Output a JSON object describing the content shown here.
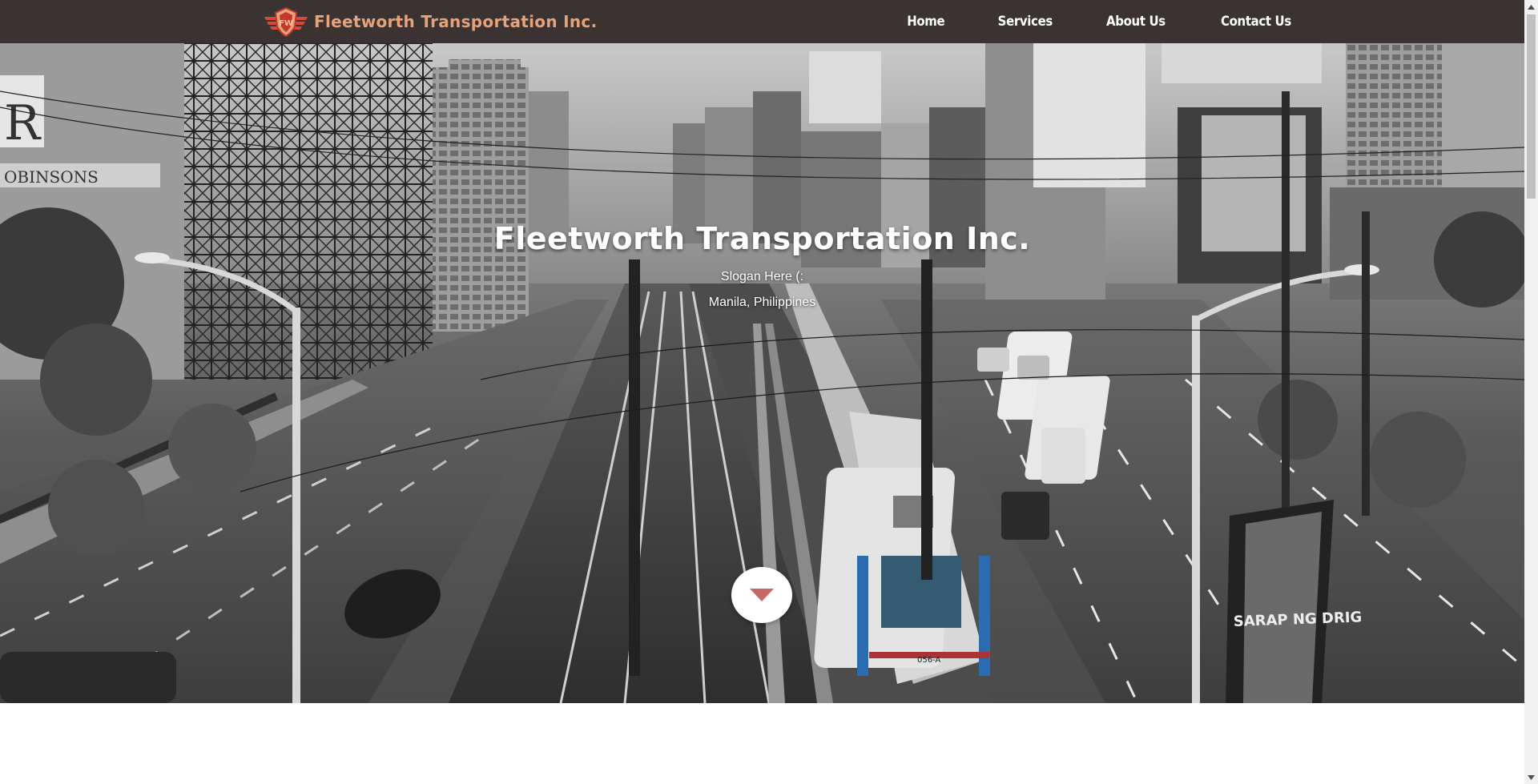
{
  "navbar": {
    "brand_name": "Fleetworth Transportation Inc.",
    "logo_icon": "fleetworth-wings-shield-logo",
    "links": [
      {
        "label": "Home"
      },
      {
        "label": "Services"
      },
      {
        "label": "About Us"
      },
      {
        "label": "Contact Us"
      }
    ],
    "colors": {
      "background": "#3a3331",
      "brand_text": "#e8a27a",
      "link_text": "#ffffff"
    }
  },
  "hero": {
    "title": "Fleetworth Transportation Inc.",
    "slogan": "Slogan Here (:",
    "location": "Manila, Philippines",
    "background": "grayscale-city-train-street-photo",
    "scroll_button_icon": "caret-down-icon",
    "scroll_button_icon_color": "#c9666a"
  }
}
